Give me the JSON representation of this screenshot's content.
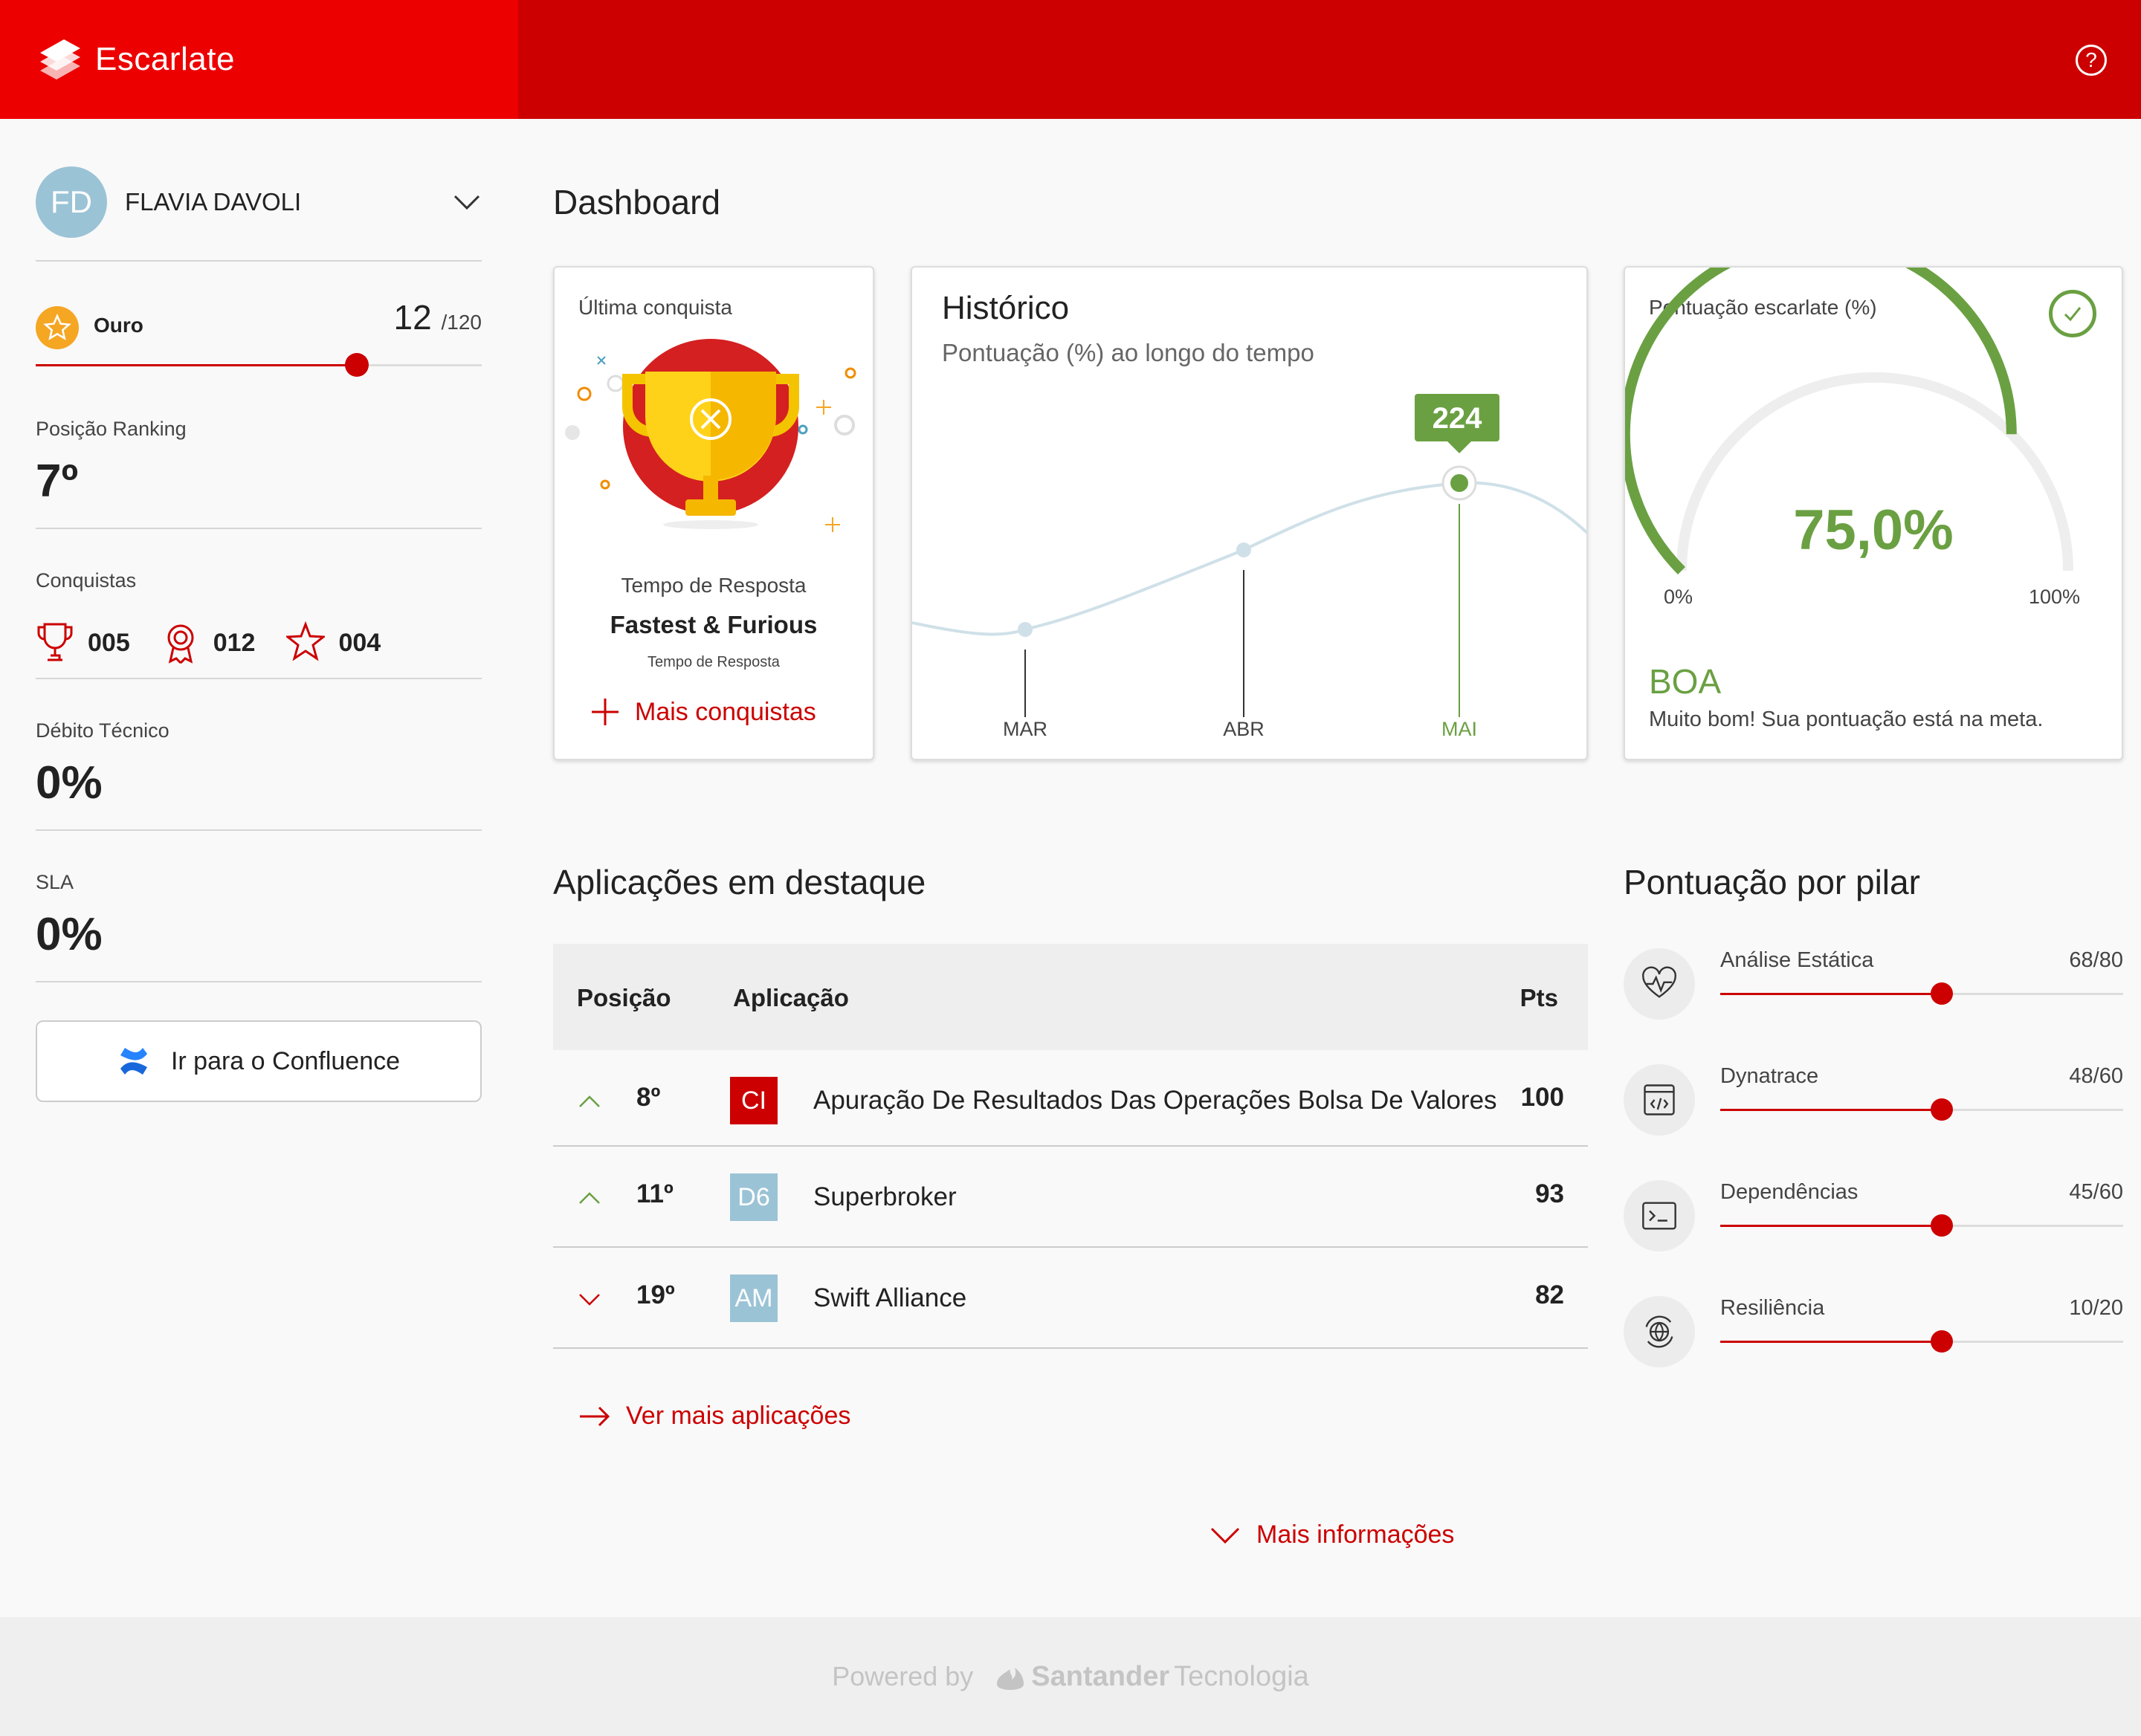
{
  "header": {
    "brand": "Escarlate",
    "help_icon": "help-circle-icon"
  },
  "user": {
    "initials": "FD",
    "name": "FLAVIA DAVOLI"
  },
  "level": {
    "name": "Ouro",
    "score": "12",
    "max": "/120",
    "progress": 0.72
  },
  "ranking": {
    "label": "Posição Ranking",
    "value": "7º"
  },
  "achievements": {
    "label": "Conquistas",
    "items": [
      {
        "icon": "trophy-icon",
        "count": "005"
      },
      {
        "icon": "medal-icon",
        "count": "012"
      },
      {
        "icon": "star-icon",
        "count": "004"
      }
    ]
  },
  "tech_debt": {
    "label": "Débito Técnico",
    "value": "0%"
  },
  "sla": {
    "label": "SLA",
    "value": "0%"
  },
  "confluence": {
    "label": "Ir para o Confluence"
  },
  "page_title": "Dashboard",
  "last_achievement": {
    "title": "Última conquista",
    "category": "Tempo de Resposta",
    "name": "Fastest & Furious",
    "subtitle": "Tempo de Resposta",
    "more_label": "Mais conquistas"
  },
  "history": {
    "title": "Histórico",
    "subtitle": "Pontuação (%) ao longo do tempo",
    "tooltip": "224"
  },
  "chart_data": {
    "type": "line",
    "title": "Histórico",
    "subtitle": "Pontuação (%) ao longo do tempo",
    "categories": [
      "MAR",
      "ABR",
      "MAI"
    ],
    "highlighted": "MAI",
    "highlighted_label": "224"
  },
  "score": {
    "title": "Pontuação escarlate (%)",
    "value": "75,0%",
    "fraction": 0.75,
    "min_label": "0%",
    "max_label": "100%",
    "grade": "BOA",
    "message": "Muito bom! Sua pontuação está na meta."
  },
  "apps": {
    "title": "Aplicações em destaque",
    "headers": {
      "position": "Posição",
      "app": "Aplicação",
      "pts": "Pts"
    },
    "rows": [
      {
        "trend": "up",
        "position": "8º",
        "badge": "CI",
        "badge_color": "#cc0000",
        "name": "Apuração De Resultados Das Operações Bolsa De Valores",
        "pts": "100"
      },
      {
        "trend": "up",
        "position": "11º",
        "badge": "D6",
        "badge_color": "#9bc3d6",
        "name": "Superbroker",
        "pts": "93"
      },
      {
        "trend": "down",
        "position": "19º",
        "badge": "AM",
        "badge_color": "#9bc3d6",
        "name": "Swift Alliance",
        "pts": "82"
      }
    ],
    "see_more": "Ver mais aplicações"
  },
  "pillars": {
    "title": "Pontuação por pilar",
    "items": [
      {
        "icon": "heartbeat-icon",
        "name": "Análise Estática",
        "score": "68/80",
        "progress": 0.55
      },
      {
        "icon": "code-window-icon",
        "name": "Dynatrace",
        "score": "48/60",
        "progress": 0.55
      },
      {
        "icon": "terminal-icon",
        "name": "Dependências",
        "score": "45/60",
        "progress": 0.55
      },
      {
        "icon": "globe-refresh-icon",
        "name": "Resiliência",
        "score": "10/20",
        "progress": 0.55
      }
    ]
  },
  "more_info": "Mais informações",
  "footer": {
    "powered": "Powered by",
    "brand": "Santander",
    "brand2": "Tecnologia"
  },
  "colors": {
    "primary": "#cc0000",
    "brand_red": "#ec0000",
    "success": "#6aa042",
    "muted_blue": "#9bc3d6"
  }
}
